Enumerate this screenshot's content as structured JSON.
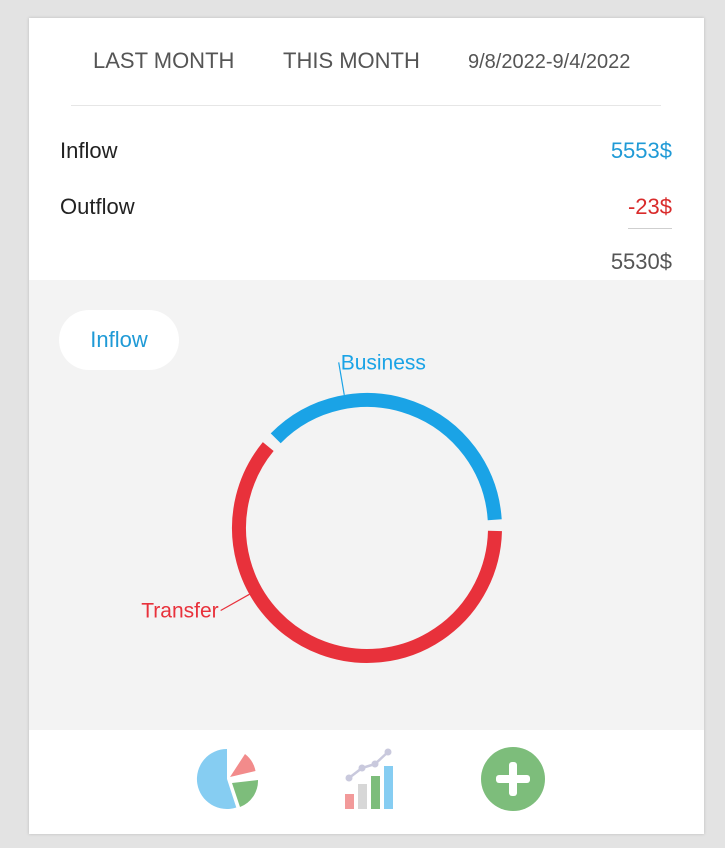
{
  "tabs": {
    "last_month": "LAST MONTH",
    "this_month": "THIS MONTH",
    "date_range": "9/8/2022-9/4/2022"
  },
  "summary": {
    "inflow_label": "Inflow",
    "inflow_value": "5553$",
    "outflow_label": "Outflow",
    "outflow_value": "-23$",
    "total_value": "5530$"
  },
  "chart_section": {
    "toggle_label": "Inflow"
  },
  "colors": {
    "inflow": "#1f9ad6",
    "outflow": "#d92b2b",
    "business": "#1aa3e6",
    "transfer": "#e8313b",
    "add": "#7dbd7b"
  },
  "bottom_nav": {
    "pie_icon": "pie-chart-icon",
    "stats_icon": "bar-chart-trend-icon",
    "add_icon": "plus-circle-icon"
  },
  "chart_data": {
    "type": "pie",
    "style": "donut",
    "categories": [
      "Business",
      "Transfer"
    ],
    "values": [
      38,
      62
    ],
    "colors": [
      "#1aa3e6",
      "#e8313b"
    ]
  }
}
